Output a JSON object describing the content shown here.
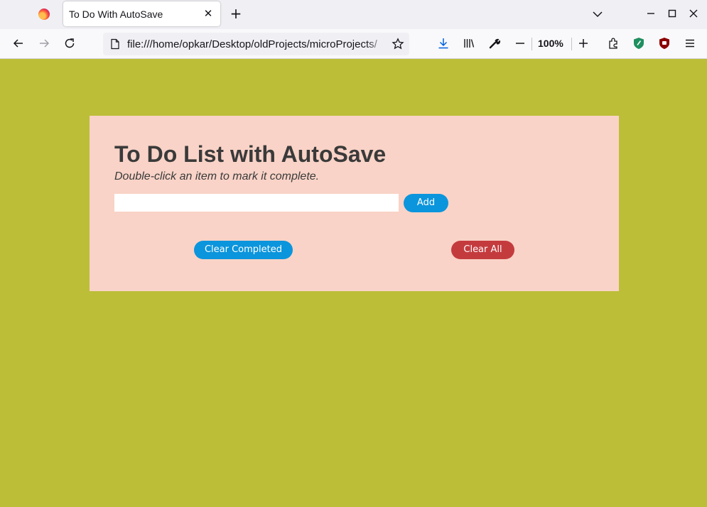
{
  "browser": {
    "tab": {
      "title": "To Do With AutoSave",
      "close_glyph": "✕"
    },
    "new_tab_glyph": "+",
    "url": "file:///home/opkar/Desktop/oldProjects/microProjects/",
    "zoom": "100%",
    "icons": [
      "firefox-icon",
      "back-icon",
      "forward-icon",
      "reload-icon",
      "page-icon",
      "bookmark-star-icon",
      "downloads-icon",
      "library-icon",
      "wrench-icon",
      "zoom-out-icon",
      "zoom-in-icon",
      "extensions-icon",
      "privacy-shield-icon",
      "ublock-icon",
      "menu-icon",
      "minimize-icon",
      "maximize-icon",
      "close-icon"
    ]
  },
  "page": {
    "title": "To Do List with AutoSave",
    "subtitle": "Double-click an item to mark it complete.",
    "input": {
      "value": "",
      "placeholder": ""
    },
    "add_label": "Add",
    "clear_completed_label": "Clear Completed",
    "clear_all_label": "Clear All"
  },
  "colors": {
    "page_background": "#bcbe38",
    "card_background": "#f9d3c7",
    "primary_button": "#0b95dc",
    "danger_button": "#c43b3e"
  }
}
